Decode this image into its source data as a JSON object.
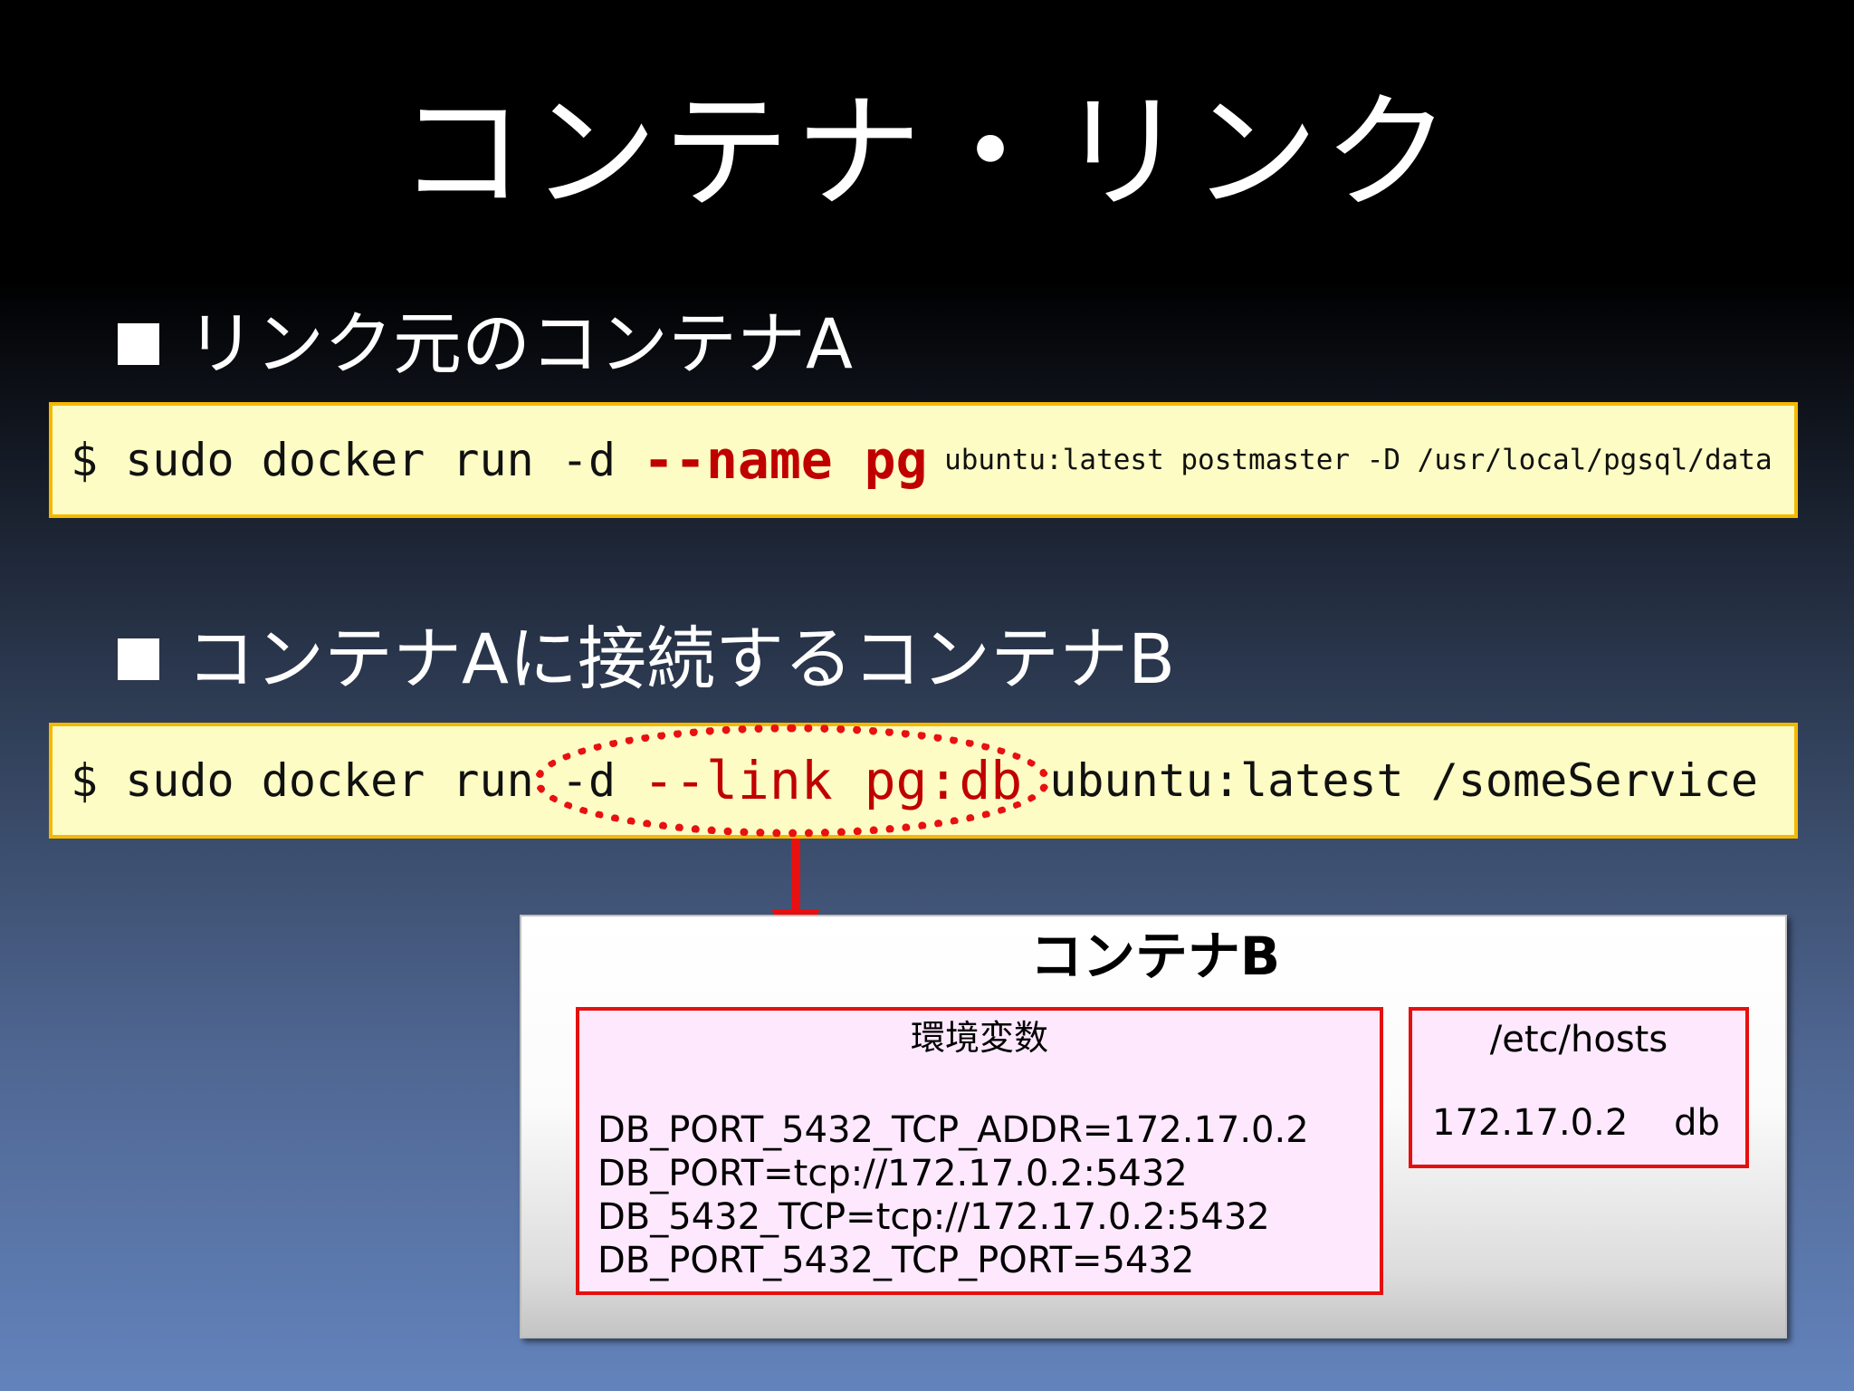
{
  "slide": {
    "title": "コンテナ・リンク",
    "bullet_a": "リンク元のコンテナA",
    "bullet_b": "コンテナAに接続するコンテナB"
  },
  "command_a": {
    "prefix": "$ sudo docker run -d ",
    "highlight": "--name pg",
    "suffix": " ubuntu:latest postmaster -D /usr/local/pgsql/data"
  },
  "command_b": {
    "prefix": "$ sudo docker run -d ",
    "highlight": "--link pg:db",
    "suffix": " ubuntu:latest /someService"
  },
  "container_b": {
    "title": "コンテナB",
    "env": {
      "title": "環境変数",
      "lines": [
        "DB_PORT_5432_TCP_ADDR=172.17.0.2",
        "DB_PORT=tcp://172.17.0.2:5432",
        "DB_5432_TCP=tcp://172.17.0.2:5432",
        "DB_PORT_5432_TCP_PORT=5432"
      ]
    },
    "hosts": {
      "title": "/etc/hosts",
      "ip": "172.17.0.2",
      "name": "db"
    }
  },
  "colors": {
    "command_box_fill": "#fcfcc4",
    "command_box_border": "#f5b800",
    "highlight_red": "#c00000",
    "annotation_red": "#e81010",
    "inner_box_fill": "#fde8fd"
  }
}
